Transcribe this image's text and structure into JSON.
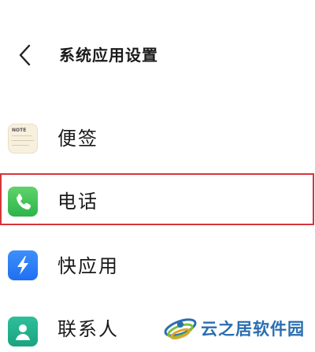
{
  "header": {
    "title": "系统应用设置"
  },
  "items": [
    {
      "label": "便签",
      "icon": "notes-icon",
      "icon_text": "NOTE"
    },
    {
      "label": "电话",
      "icon": "phone-icon",
      "highlighted": true
    },
    {
      "label": "快应用",
      "icon": "quick-app-icon"
    },
    {
      "label": "联系人",
      "icon": "contacts-icon"
    }
  ],
  "watermark": {
    "text": "云之居软件园"
  },
  "colors": {
    "highlight_border": "#d5363b",
    "phone_green": "#2db44a",
    "quickapp_blue": "#1f6ff2",
    "watermark_blue": "#2a6db0"
  }
}
